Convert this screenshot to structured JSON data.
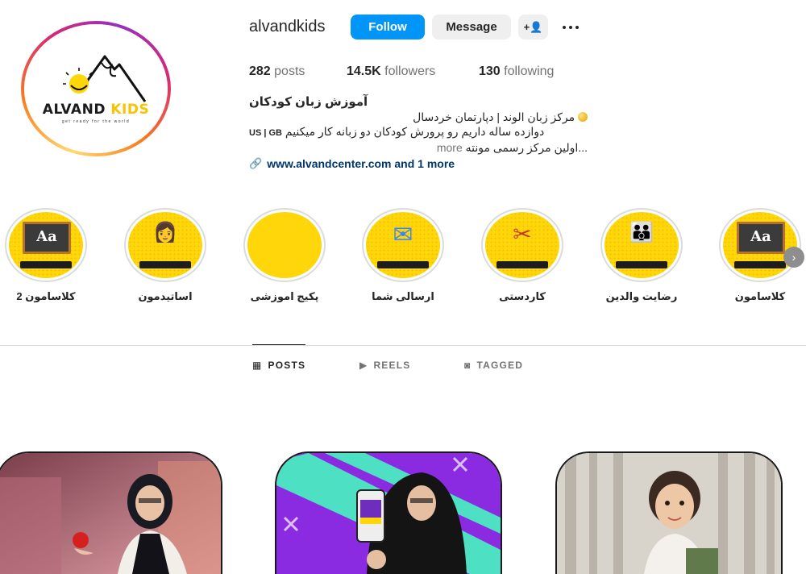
{
  "profile": {
    "username": "alvandkids",
    "logo_line1": "ALVAND",
    "logo_line2": "KIDS",
    "logo_tagline": "get ready for the world"
  },
  "actions": {
    "follow_label": "Follow",
    "message_label": "Message",
    "add_user_icon": "+👤",
    "more_icon": "more-dots-icon"
  },
  "stats": {
    "posts_count": "282",
    "posts_label": "posts",
    "followers_count": "14.5K",
    "followers_label": "followers",
    "following_count": "130",
    "following_label": "following"
  },
  "bio": {
    "name": "آموزش زبان کودکان",
    "line1": "مرکز زبان الوند | دپارتمان خردسال",
    "line2": "دوازده ساله داریم رو پرورش کودکان دو زبانه کار میکنیم",
    "line2_flags": "US | GB",
    "line3": "...اولین مرکز رسمی مونته",
    "more": "more",
    "link": "www.alvandcenter.com and 1 more"
  },
  "highlights": [
    {
      "label": "کلاسامون 2",
      "icon": "chalkboard-icon",
      "board_text": "Aa"
    },
    {
      "label": "اساتیدمون",
      "icon": "teacher-icon",
      "glyph": "👩"
    },
    {
      "label": "پکیج اموزشی",
      "icon": "blank-icon"
    },
    {
      "label": "ارسالی شما",
      "icon": "envelope-icon",
      "glyph": "✉"
    },
    {
      "label": "کاردستی",
      "icon": "scissors-icon",
      "glyph": "✂"
    },
    {
      "label": "رضایت والدین",
      "icon": "family-icon",
      "glyph": "👪"
    },
    {
      "label": "کلاسامون",
      "icon": "chalkboard-icon",
      "board_text": "Aa"
    }
  ],
  "tabs": [
    {
      "label": "POSTS",
      "icon": "▦",
      "active": true
    },
    {
      "label": "REELS",
      "icon": "▶",
      "active": false
    },
    {
      "label": "TAGGED",
      "icon": "◙",
      "active": false
    }
  ],
  "colors": {
    "follow_blue": "#0095f6",
    "highlight_yellow": "#ffd60a",
    "link_blue": "#00376b"
  }
}
